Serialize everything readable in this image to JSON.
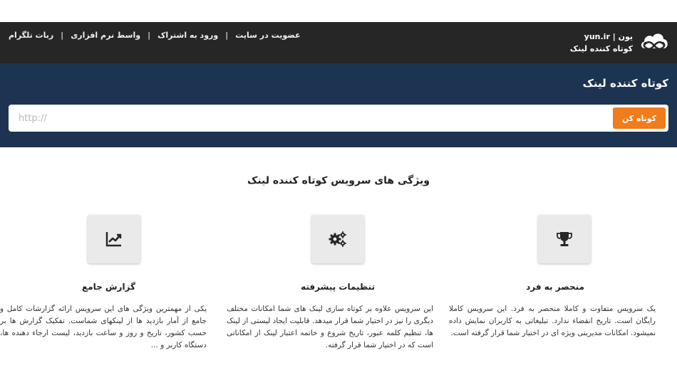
{
  "nav": {
    "links": [
      "ربات تلگرام",
      "واسط نرم افزاری",
      "ورود به اشتراک",
      "عضویت در سایت"
    ],
    "separator": "|"
  },
  "brand": {
    "name_fa": "یون",
    "domain": "yun.ir",
    "tagline": "کوتاه کننده لینک"
  },
  "hero": {
    "title": "کوتاه کننده لینک",
    "input_placeholder": "http://",
    "button_label": "کوتاه کن"
  },
  "features": {
    "title": "ویژگی های سرویس کوتاه کننده لینک",
    "items": [
      {
        "icon": "trophy-icon",
        "title": "منحصر به فرد",
        "desc": "یک سرویس متفاوت و کاملا منحصر به فرد. این سرویس کاملا رایگان است. تاریخ انقضاء ندارد. تبلیغاتی به کاربران نمایش داده نمیشود. امکانات مدیریتی ویژه ای در اختیار شما قرار گرفته است."
      },
      {
        "icon": "gears-icon",
        "title": "تنظیمات پیشرفته",
        "desc": "این سرویس علاوه بر کوتاه سازی لینک های شما امکانات مختلف دیگری را نیز در اختیار شما قرار میدهد. قابلیت ایجاد لیستی از لینک ها، تنظیم کلمه عبور، تاریخ شروع و خاتمه اعتبار لینک از امکاناتی است که در اختیار شما قرار گرفته."
      },
      {
        "icon": "line-chart-icon",
        "title": "گزارش جامع",
        "desc": "یکی از مهمترین ویژگی های این سرویس ارائه گزارشات کامل و جامع از آمار بازدید ها از لینکهای شماست. تفکیک گزارش ها بر حسب کشور، تاریخ و روز و ساعت بازدید، لیست ارجاء دهنده ها، دستگاه کاربر و ..."
      }
    ]
  }
}
